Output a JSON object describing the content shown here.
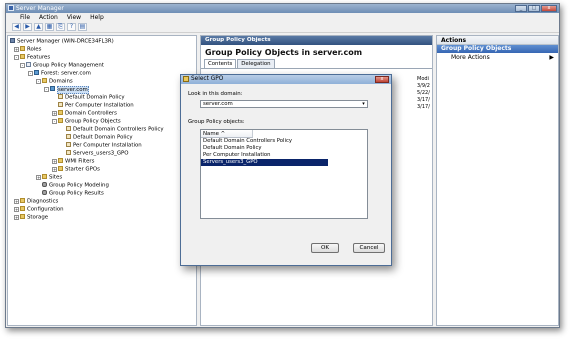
{
  "window": {
    "title": "Server Manager",
    "minimize": "_",
    "maximize": "□",
    "close": "x"
  },
  "menu": [
    "File",
    "Action",
    "View",
    "Help"
  ],
  "toolbar": [
    "◀",
    "▶",
    "▲",
    "▦",
    "⎘",
    "?",
    "▤"
  ],
  "tree": [
    {
      "label": "Server Manager (WIN-DRCE34FL3R)",
      "expander": "",
      "icon": "server-icon"
    },
    {
      "label": "Roles",
      "expander": "+",
      "icon": "folder-icon"
    },
    {
      "label": "Features",
      "expander": "-",
      "icon": "folder-icon"
    },
    {
      "label": "Group Policy Management",
      "expander": "-",
      "icon": "gpo-icon"
    },
    {
      "label": "Forest: server.com",
      "expander": "-",
      "icon": "forest-icon"
    },
    {
      "label": "Domains",
      "expander": "-",
      "icon": "folder-icon"
    },
    {
      "label": "server.com",
      "expander": "-",
      "icon": "domain-icon"
    },
    {
      "label": "Default Domain Policy",
      "expander": "",
      "icon": "gpo-link-icon"
    },
    {
      "label": "Per Computer Installation",
      "expander": "",
      "icon": "gpo-link-icon"
    },
    {
      "label": "Domain Controllers",
      "expander": "+",
      "icon": "folder-icon"
    },
    {
      "label": "Group Policy Objects",
      "expander": "-",
      "icon": "folder-icon"
    },
    {
      "label": "Default Domain Controllers Policy",
      "expander": "",
      "icon": "scroll-icon"
    },
    {
      "label": "Default Domain Policy",
      "expander": "",
      "icon": "scroll-icon"
    },
    {
      "label": "Per Computer Installation",
      "expander": "",
      "icon": "scroll-icon"
    },
    {
      "label": "Servers_users3_GPO",
      "expander": "",
      "icon": "scroll-icon"
    },
    {
      "label": "WMI Filters",
      "expander": "+",
      "icon": "folder-icon"
    },
    {
      "label": "Starter GPOs",
      "expander": "+",
      "icon": "folder-icon"
    },
    {
      "label": "Sites",
      "expander": "+",
      "icon": "folder-icon"
    },
    {
      "label": "Group Policy Modeling",
      "expander": "",
      "icon": "gear-icon"
    },
    {
      "label": "Group Policy Results",
      "expander": "",
      "icon": "gear-icon"
    },
    {
      "label": "Diagnostics",
      "expander": "+",
      "icon": "folder-icon"
    },
    {
      "label": "Configuration",
      "expander": "+",
      "icon": "folder-icon"
    },
    {
      "label": "Storage",
      "expander": "+",
      "icon": "folder-icon"
    }
  ],
  "middle": {
    "header": "Group Policy Objects",
    "title": "Group Policy Objects in server.com",
    "tabs": [
      "Contents",
      "Delegation"
    ],
    "modified_header": "Modi",
    "modified_values": [
      "3/9/2",
      "5/22/",
      "3/17/",
      "3/17/"
    ]
  },
  "actions": {
    "header": "Actions",
    "section": "Group Policy Objects",
    "more": "More Actions",
    "more_arrow": "▶"
  },
  "dialog": {
    "title": "Select GPO",
    "close": "x",
    "domain_label": "Look in this domain:",
    "domain_value": "server.com",
    "dropdown_arrow": "▾",
    "objects_label": "Group Policy objects:",
    "column_name": "Name ^",
    "items": [
      "Default Domain Controllers Policy",
      "Default Domain Policy",
      "Per Computer Installation",
      "Servers_users3_GPO"
    ],
    "selected_index": 3,
    "ok": "OK",
    "cancel": "Cancel"
  }
}
